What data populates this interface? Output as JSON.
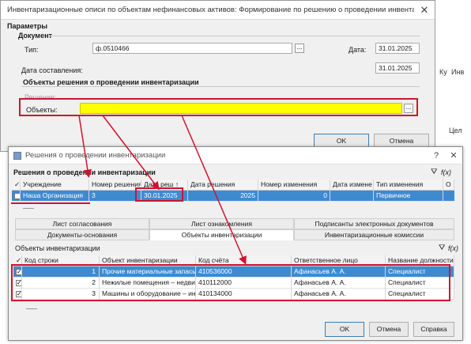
{
  "dialog1": {
    "title": "Инвентаризационные описи по объектам нефинансовых активов: Формирование по решению о проведении инвентари",
    "close": "✕",
    "params_label": "Параметры",
    "document_label": "Документ",
    "type_label": "Тип:",
    "type_value": "ф.0510466",
    "date_label": "Дата:",
    "date_value": "31.01.2025",
    "compose_date_label": "Дата составления:",
    "compose_date_value": "31.01.2025",
    "objects_section": "Объекты решения о проведении инвентаризации",
    "decision_label": "Решение:",
    "objects_label": "Объекты:",
    "ellipsis": "...",
    "ok": "OK",
    "cancel": "Отмена",
    "right_fragments": [
      "Ку",
      "Инв",
      "Цел"
    ]
  },
  "dialog2": {
    "title": "Решения о проведении инвентаризации",
    "help": "?",
    "close": "✕",
    "grid_title": "Решения о проведении инвентаризации",
    "decisions_columns": [
      "✓",
      "Учреждение",
      "Номер решения",
      "Дата реш ↑",
      "Дата решения",
      "Номер изменения",
      "Дата измене",
      "Тип изменения",
      "О"
    ],
    "decisions_rows": [
      {
        "org": "Наша Организация",
        "number": "3",
        "date": "30.01.2025",
        "year": "2025",
        "change_no": "0",
        "change_date": "",
        "change_type": "Первичное"
      }
    ],
    "tabs_row1": [
      "Лист согласования",
      "Лист ознакомления",
      "Подписанты электронных документов"
    ],
    "tabs_row2": [
      "Документы-основания",
      "Объекты инвентаризации",
      "Инвентаризационные комиссии"
    ],
    "objects_title": "Объекты инвентаризации",
    "objects_columns": [
      "✓",
      "Код строки",
      "Объект инвентаризации",
      "Код счёта",
      "Ответственное лицо",
      "Название должности"
    ],
    "objects_rows": [
      {
        "checked": "✓",
        "code": "1",
        "object": "Прочие материальные запасы",
        "account": "410536000",
        "person": "Афанасьев А. А.",
        "position": "Специалист"
      },
      {
        "checked": "✓",
        "code": "2",
        "object": "Нежилые помещения – недвижимость",
        "account": "410112000",
        "person": "Афанасьев А. А.",
        "position": "Специалист"
      },
      {
        "checked": "✓",
        "code": "3",
        "object": "Машины и оборудование – иное",
        "account": "410134000",
        "person": "Афанасьев А. А.",
        "position": "Специалист"
      }
    ],
    "ok": "OK",
    "cancel": "Отмена",
    "help_btn": "Справка",
    "filter_icon": "filter-icon",
    "formula_icon": "f(x)"
  },
  "colors": {
    "selection": "#3e8ad1",
    "highlight": "#ffff00",
    "annotation": "#d1122f"
  }
}
